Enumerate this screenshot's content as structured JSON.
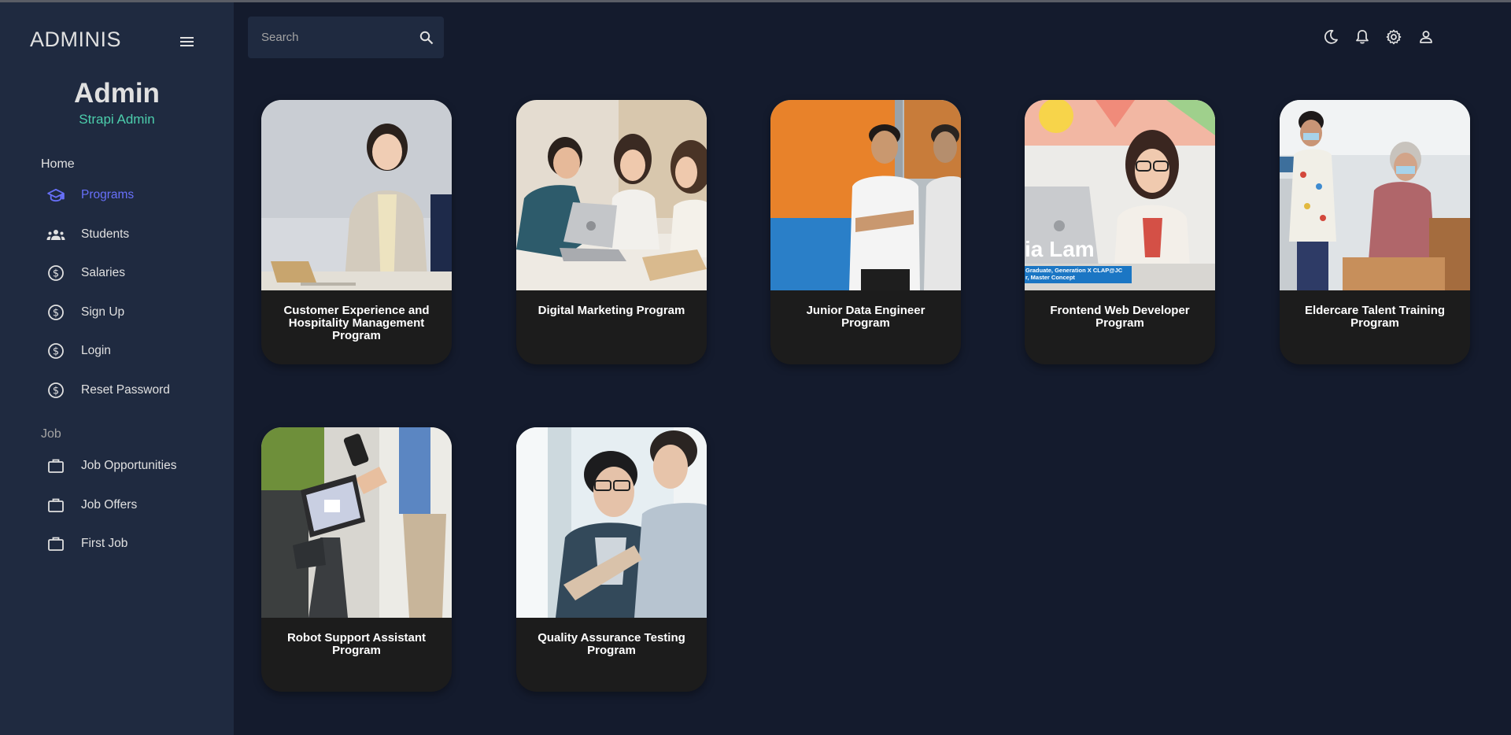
{
  "app": {
    "brand": "ADMINIS"
  },
  "profile": {
    "name": "Admin",
    "role": "Strapi Admin"
  },
  "sidebar": {
    "sections": [
      {
        "label": "Home",
        "items": [
          {
            "label": "Programs",
            "icon": "graduation-cap-icon",
            "active": true
          },
          {
            "label": "Students",
            "icon": "group-icon",
            "active": false
          },
          {
            "label": "Salaries",
            "icon": "dollar-icon",
            "active": false
          },
          {
            "label": "Sign Up",
            "icon": "dollar-icon",
            "active": false
          },
          {
            "label": "Login",
            "icon": "dollar-icon",
            "active": false
          },
          {
            "label": "Reset Password",
            "icon": "dollar-icon",
            "active": false
          }
        ]
      },
      {
        "label": "Job",
        "items": [
          {
            "label": "Job Opportunities",
            "icon": "briefcase-icon",
            "active": false
          },
          {
            "label": "Job Offers",
            "icon": "briefcase-icon",
            "active": false
          },
          {
            "label": "First Job",
            "icon": "briefcase-icon",
            "active": false
          }
        ]
      }
    ]
  },
  "search": {
    "placeholder": "Search"
  },
  "topbar": {
    "icons": [
      "dark-mode-icon",
      "notifications-icon",
      "settings-icon",
      "user-icon"
    ]
  },
  "programs": [
    {
      "title": "Customer Experience and Hospitality Management Program"
    },
    {
      "title": "Digital Marketing Program"
    },
    {
      "title": "Junior Data Engineer Program"
    },
    {
      "title": "Frontend Web Developer Program",
      "photo_caption_1": "ia Lam",
      "photo_caption_2": "Graduate, Generation X CLAP@JC",
      "photo_caption_3": "r, Master Concept"
    },
    {
      "title": "Eldercare Talent Training Program"
    },
    {
      "title": "Robot Support Assistant Program"
    },
    {
      "title": "Quality Assurance Testing Program"
    }
  ],
  "colors": {
    "background": "#141b2d",
    "sidebar": "#1f2a40",
    "accent": "#6870fa",
    "role": "#4cceac",
    "card": "#1c1c1c"
  }
}
